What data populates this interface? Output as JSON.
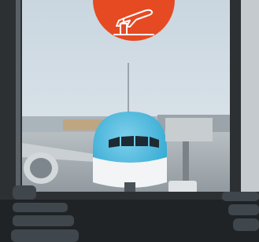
{
  "image": {
    "subject": "airport-terminal-window-with-airliner",
    "badge_icon": "airplane-departure-icon"
  },
  "colors": {
    "accent": "#e64a23",
    "sky_top": "#c9d6e0",
    "sky_bottom": "#e7ecef",
    "fuselage": "#2aa5cf",
    "window_frame": "#2d3032",
    "floor": "#1f2326",
    "seats": "#3f464c"
  }
}
